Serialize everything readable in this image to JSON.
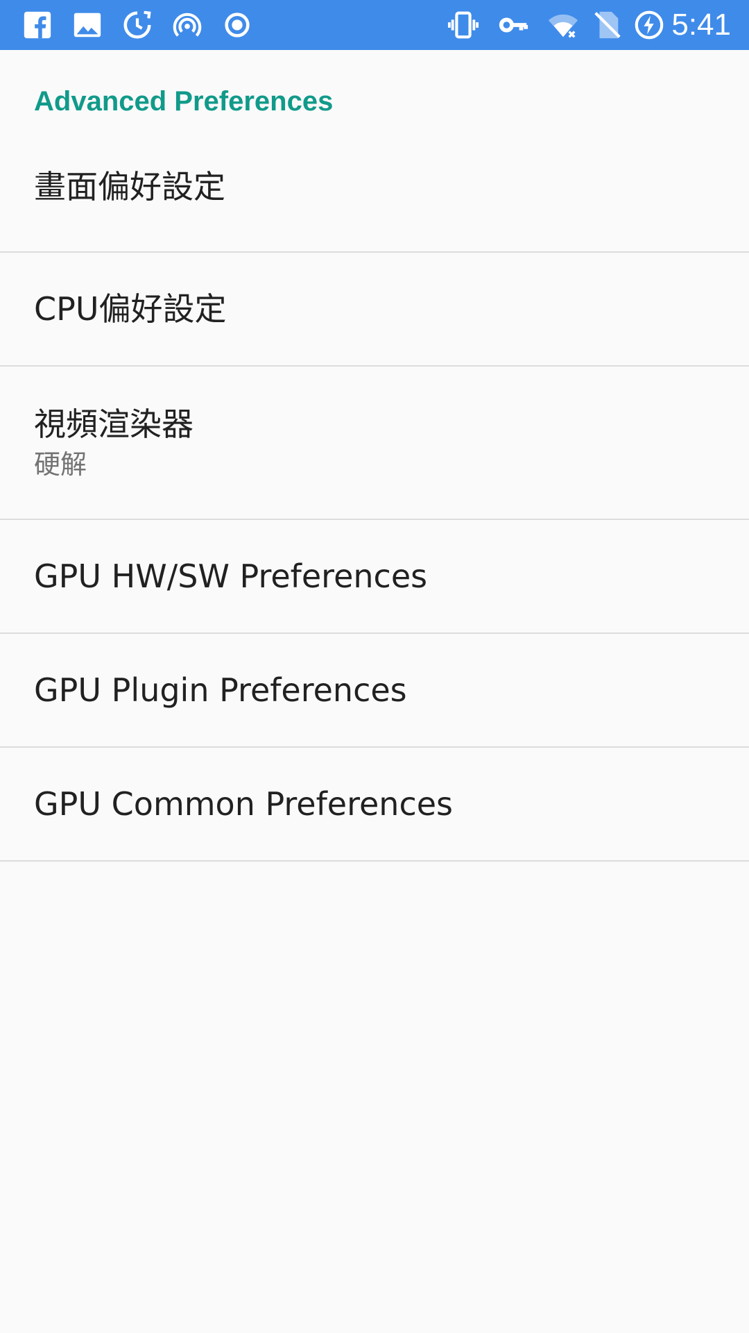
{
  "status_bar": {
    "time": "5:41",
    "left_icons": [
      "facebook-icon",
      "image-icon",
      "sync-clock-icon",
      "hotspot-icon",
      "record-icon"
    ],
    "right_icons": [
      "vibrate-icon",
      "vpn-key-icon",
      "wifi-off-icon",
      "no-sim-icon",
      "battery-charging-icon"
    ],
    "background_color": "#3f8bea"
  },
  "category": {
    "title": "Advanced Preferences",
    "color": "#119a8a"
  },
  "preferences": [
    {
      "title": "畫面偏好設定",
      "summary": ""
    },
    {
      "title": "CPU偏好設定",
      "summary": ""
    },
    {
      "title": "視頻渲染器",
      "summary": "硬解"
    },
    {
      "title": "GPU HW/SW Preferences",
      "summary": ""
    },
    {
      "title": "GPU Plugin Preferences",
      "summary": ""
    },
    {
      "title": "GPU Common Preferences",
      "summary": ""
    }
  ]
}
